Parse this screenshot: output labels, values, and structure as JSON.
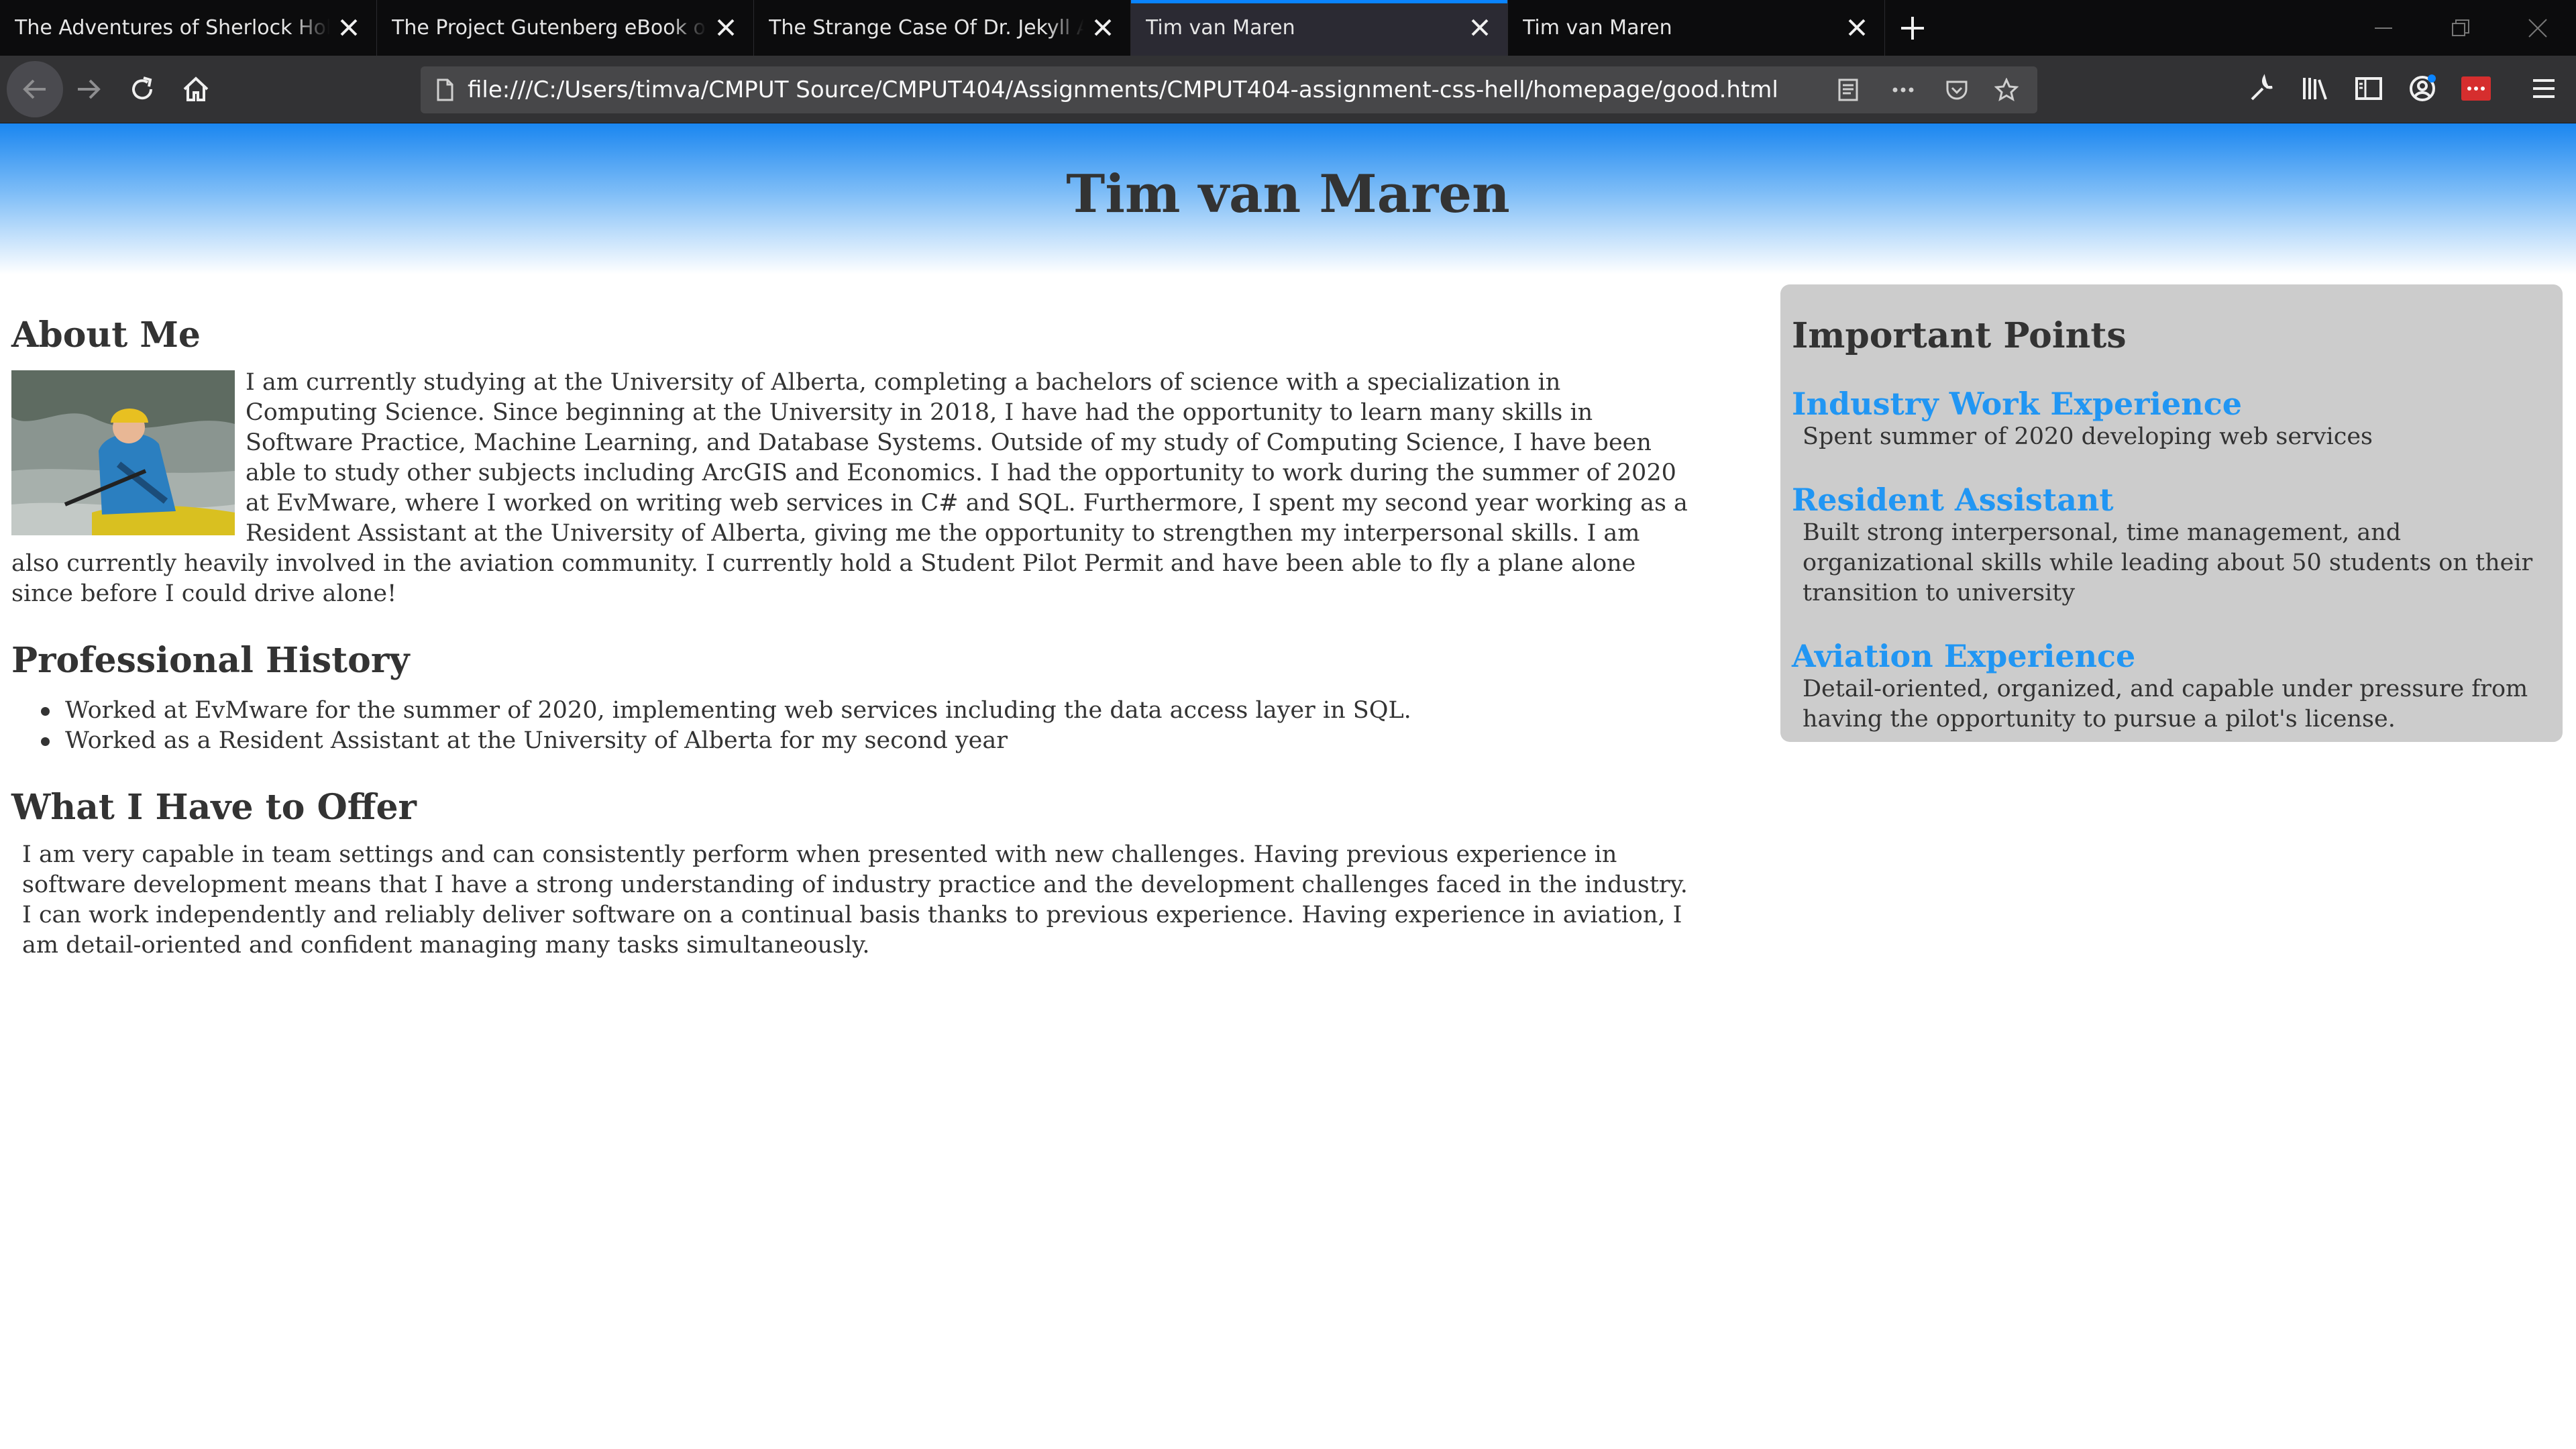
{
  "browser": {
    "tabs": [
      {
        "title": "The Adventures of Sherlock Holmes",
        "active": false
      },
      {
        "title": "The Project Gutenberg eBook of The",
        "active": false
      },
      {
        "title": "The Strange Case Of Dr. Jekyll And",
        "active": false
      },
      {
        "title": "Tim van Maren",
        "active": true
      },
      {
        "title": "Tim van Maren",
        "active": false
      }
    ],
    "url": "file:///C:/Users/timva/CMPUT Source/CMPUT404/Assignments/CMPUT404-assignment-css-hell/homepage/good.html",
    "accent_color": "#0a84ff"
  },
  "page": {
    "title": "Tim van Maren",
    "about": {
      "heading": "About Me",
      "text": "I am currently studying at the University of Alberta, completing a bachelors of science with a specialization in Computing Science. Since beginning at the University in 2018, I have had the opportunity to learn many skills in Software Practice, Machine Learning, and Database Systems. Outside of my study of Computing Science, I have been able to study other subjects including ArcGIS and Economics. I had the opportunity to work during the summer of 2020 at EvMware, where I worked on writing web services in C# and SQL. Furthermore, I spent my second year working as a Resident Assistant at the University of Alberta, giving me the opportunity to strengthen my interpersonal skills. I am also currently heavily involved in the aviation community. I currently hold a Student Pilot Permit and have been able to fly a plane alone since before I could drive alone!"
    },
    "history": {
      "heading": "Professional History",
      "items": [
        "Worked at EvMware for the summer of 2020, implementing web services including the data access layer in SQL.",
        "Worked as a Resident Assistant at the University of Alberta for my second year"
      ]
    },
    "offer": {
      "heading": "What I Have to Offer",
      "text": "I am very capable in team settings and can consistently perform when presented with new challenges. Having previous experience in software development means that I have a strong understanding of industry practice and the development challenges faced in the industry. I can work independently and reliably deliver software on a continual basis thanks to previous experience. Having experience in aviation, I am detail-oriented and confident managing many tasks simultaneously."
    },
    "sidebar": {
      "heading": "Important Points",
      "points": [
        {
          "title": "Industry Work Experience",
          "desc": "Spent summer of 2020 developing web services"
        },
        {
          "title": "Resident Assistant",
          "desc": "Built strong interpersonal, time management, and organizational skills while leading about 50 students on their transition to university"
        },
        {
          "title": "Aviation Experience",
          "desc": "Detail-oriented, organized, and capable under pressure from having the opportunity to pursue a pilot's license."
        }
      ],
      "link_color": "#2196f3"
    }
  }
}
